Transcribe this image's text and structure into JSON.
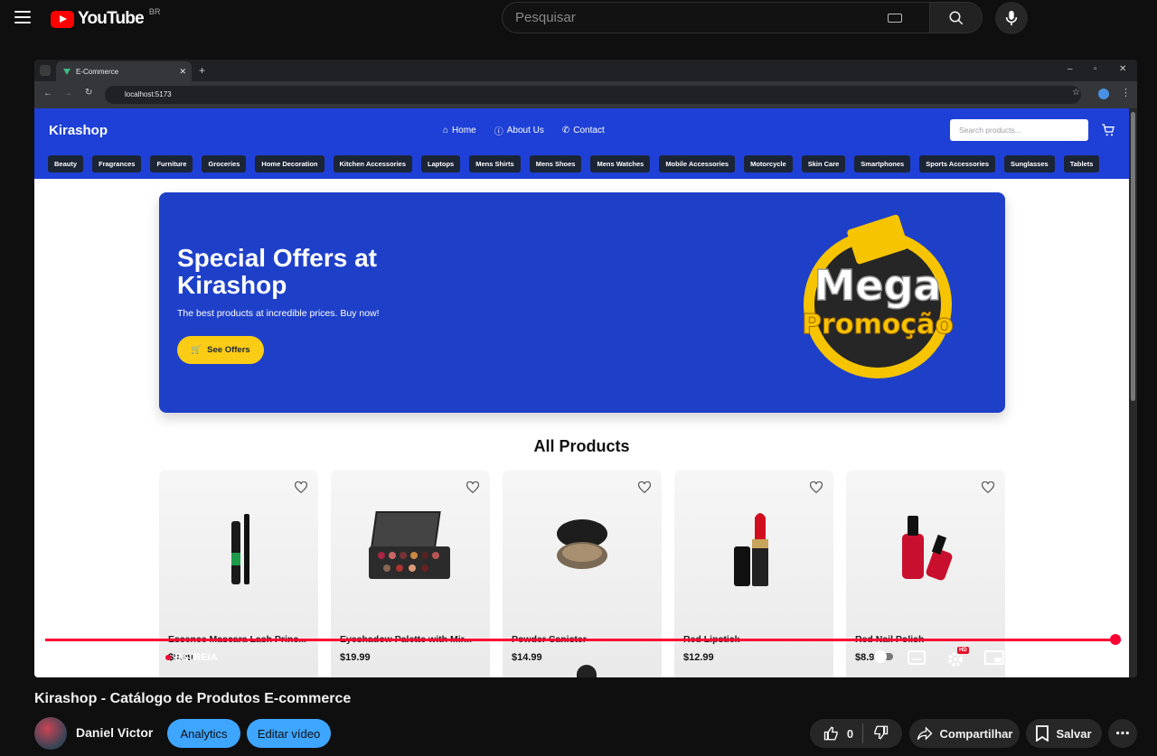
{
  "youtube": {
    "logo_text": "YouTube",
    "country_code": "BR",
    "search_placeholder": "Pesquisar"
  },
  "browser": {
    "tab_title": "E-Commerce",
    "url": "localhost:5173"
  },
  "site": {
    "brand": "Kirashop",
    "nav": {
      "home": "Home",
      "about": "About Us",
      "contact": "Contact"
    },
    "search_placeholder": "Search products...",
    "categories": [
      "Beauty",
      "Fragrances",
      "Furniture",
      "Groceries",
      "Home Decoration",
      "Kitchen Accessories",
      "Laptops",
      "Mens Shirts",
      "Mens Shoes",
      "Mens Watches",
      "Mobile Accessories",
      "Motorcycle",
      "Skin Care",
      "Smartphones",
      "Sports Accessories",
      "Sunglasses",
      "Tablets"
    ],
    "hero": {
      "title": "Special Offers at Kirashop",
      "subtitle": "The best products at incredible prices. Buy now!",
      "button": "See Offers",
      "badge_line1": "Mega",
      "badge_line2": "Promoção"
    },
    "section_title": "All Products",
    "products": [
      {
        "name": "Essence Mascara Lash Princ...",
        "price": "$9.99"
      },
      {
        "name": "Eyeshadow Palette with Mir...",
        "price": "$19.99"
      },
      {
        "name": "Powder Canister",
        "price": "$14.99"
      },
      {
        "name": "Red Lipstick",
        "price": "$12.99"
      },
      {
        "name": "Red Nail Polish",
        "price": "$8.99"
      }
    ]
  },
  "player": {
    "live_label": "ESTREIA",
    "progress": 0.995,
    "accent": "#ff0033",
    "hd_badge": "HD"
  },
  "video_info": {
    "title": "Kirashop - Catálogo de Produtos E-commerce",
    "channel": "Daniel Victor",
    "analytics": "Analytics",
    "edit": "Editar vídeo",
    "likes": "0",
    "share": "Compartilhar",
    "save": "Salvar"
  }
}
